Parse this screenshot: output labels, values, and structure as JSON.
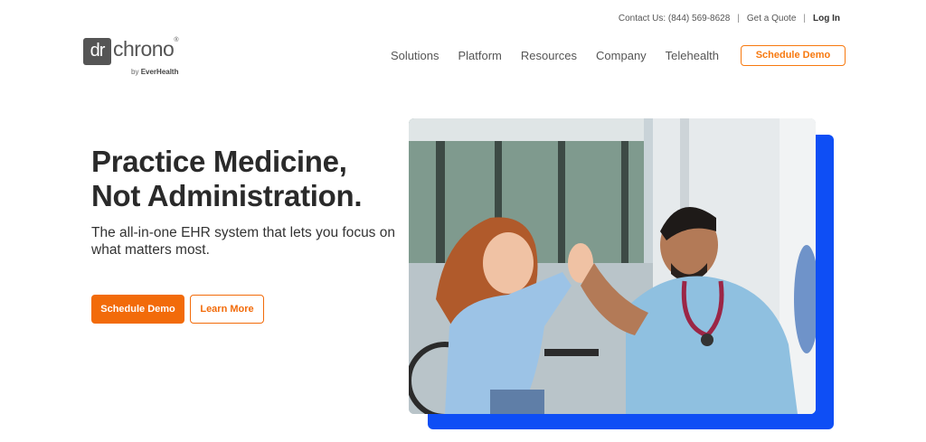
{
  "topbar": {
    "contact": "Contact Us: (844) 569-8628",
    "quote": "Get a Quote",
    "login": "Log In",
    "separator": "|"
  },
  "logo": {
    "dr": "dr",
    "chrono": "chrono",
    "reg": "®",
    "by_prefix": "by",
    "by_brand": "EverHealth"
  },
  "nav": {
    "items": [
      "Solutions",
      "Platform",
      "Resources",
      "Company",
      "Telehealth"
    ],
    "cta": "Schedule Demo"
  },
  "hero": {
    "headline_line1": "Practice Medicine,",
    "headline_line2": "Not Administration.",
    "subhead": "The all-in-one EHR system that lets you focus on what matters most.",
    "primary_cta": "Schedule Demo",
    "secondary_cta": "Learn More"
  },
  "colors": {
    "accent": "#f26b0a",
    "blue": "#0e4ef5",
    "text": "#2a2a2a"
  },
  "image": {
    "subject": "photo-doctor-high-five-child-icon"
  }
}
